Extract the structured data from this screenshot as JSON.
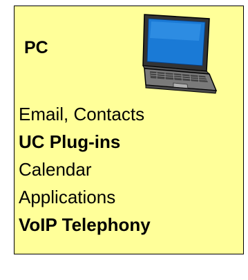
{
  "card": {
    "title": "PC",
    "icon": "laptop-icon",
    "background_color": "#ffff99",
    "items": [
      {
        "label": "Email, Contacts",
        "bold": false
      },
      {
        "label": "UC Plug-ins",
        "bold": true
      },
      {
        "label": "Calendar",
        "bold": false
      },
      {
        "label": "Applications",
        "bold": false
      },
      {
        "label": "VoIP Telephony",
        "bold": true
      }
    ]
  }
}
